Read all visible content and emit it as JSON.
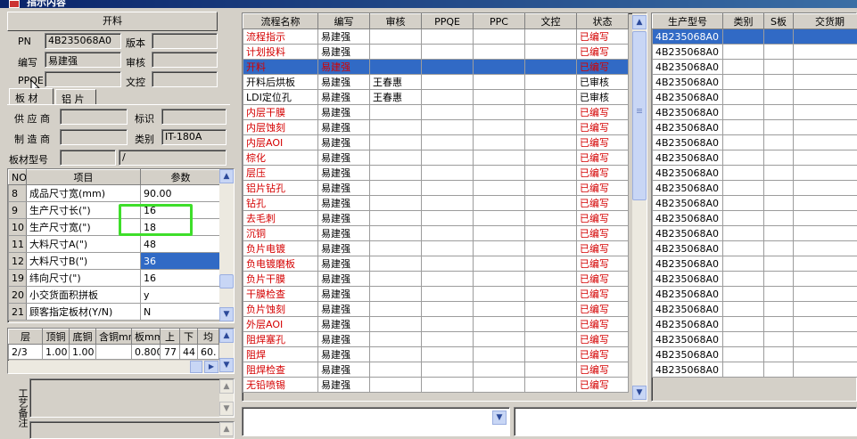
{
  "window": {
    "title": "指示内容"
  },
  "left_panel": {
    "header": "开料",
    "pn_label": "PN",
    "pn_value": "4B235068A0",
    "version_label": "版本",
    "author_label": "编写",
    "author_value": "易建强",
    "review_label": "审核",
    "ppqe_label": "PPQE",
    "doc_control_label": "文控",
    "tabs": [
      "板 材",
      "铝 片"
    ],
    "supplier_label": "供 应 商",
    "mark_label": "标识",
    "manufacturer_label": "制 造 商",
    "category_label": "类别",
    "category_value": "IT-180A",
    "board_model_label": "板材型号",
    "board_model_value": "/"
  },
  "params_table": {
    "headers": [
      "NO",
      "项目",
      "参数"
    ],
    "rows": [
      {
        "no": "8",
        "item": "成品尺寸宽(mm)",
        "value": "90.00"
      },
      {
        "no": "9",
        "item": "生产尺寸长(\")",
        "value": "16"
      },
      {
        "no": "10",
        "item": "生产尺寸宽(\")",
        "value": "18"
      },
      {
        "no": "11",
        "item": "大料尺寸A(\")",
        "value": "48"
      },
      {
        "no": "12",
        "item": "大料尺寸B(\")",
        "value": "36"
      },
      {
        "no": "19",
        "item": "纬向尺寸(\")",
        "value": "16"
      },
      {
        "no": "20",
        "item": "小交货面积拼板",
        "value": "y"
      },
      {
        "no": "21",
        "item": "顾客指定板材(Y/N)",
        "value": "N"
      }
    ],
    "highlighted_row_index": 4
  },
  "layer_table": {
    "headers": [
      "层",
      "顶铜",
      "底铜",
      "含铜mm",
      "板mm",
      "上",
      "下",
      "均"
    ],
    "rows": [
      [
        "2/3",
        "1.00",
        "1.00",
        "",
        "0.800",
        "77",
        "44",
        "60."
      ]
    ]
  },
  "remarks": {
    "label": "工艺备注"
  },
  "flow_table": {
    "headers": [
      "流程名称",
      "编写",
      "审核",
      "PPQE",
      "PPC",
      "文控",
      "状态"
    ],
    "rows": [
      {
        "name": "流程指示",
        "author": "易建强",
        "reviewer": "",
        "status": "已编写",
        "state": "draft"
      },
      {
        "name": "计划投料",
        "author": "易建强",
        "reviewer": "",
        "status": "已编写",
        "state": "draft"
      },
      {
        "name": "开料",
        "author": "易建强",
        "reviewer": "",
        "status": "已编写",
        "state": "selected"
      },
      {
        "name": "开料后烘板",
        "author": "易建强",
        "reviewer": "王春惠",
        "status": "已审核",
        "state": "reviewed"
      },
      {
        "name": "LDI定位孔",
        "author": "易建强",
        "reviewer": "王春惠",
        "status": "已审核",
        "state": "reviewed"
      },
      {
        "name": "内层干膜",
        "author": "易建强",
        "reviewer": "",
        "status": "已编写",
        "state": "draft"
      },
      {
        "name": "内层蚀刻",
        "author": "易建强",
        "reviewer": "",
        "status": "已编写",
        "state": "draft"
      },
      {
        "name": "内层AOI",
        "author": "易建强",
        "reviewer": "",
        "status": "已编写",
        "state": "draft"
      },
      {
        "name": "棕化",
        "author": "易建强",
        "reviewer": "",
        "status": "已编写",
        "state": "draft"
      },
      {
        "name": "层压",
        "author": "易建强",
        "reviewer": "",
        "status": "已编写",
        "state": "draft"
      },
      {
        "name": "铝片钻孔",
        "author": "易建强",
        "reviewer": "",
        "status": "已编写",
        "state": "draft"
      },
      {
        "name": "钻孔",
        "author": "易建强",
        "reviewer": "",
        "status": "已编写",
        "state": "draft"
      },
      {
        "name": "去毛刺",
        "author": "易建强",
        "reviewer": "",
        "status": "已编写",
        "state": "draft"
      },
      {
        "name": "沉铜",
        "author": "易建强",
        "reviewer": "",
        "status": "已编写",
        "state": "draft"
      },
      {
        "name": "负片电镀",
        "author": "易建强",
        "reviewer": "",
        "status": "已编写",
        "state": "draft"
      },
      {
        "name": "负电镀磨板",
        "author": "易建强",
        "reviewer": "",
        "status": "已编写",
        "state": "draft"
      },
      {
        "name": "负片干膜",
        "author": "易建强",
        "reviewer": "",
        "status": "已编写",
        "state": "draft"
      },
      {
        "name": "干膜检查",
        "author": "易建强",
        "reviewer": "",
        "status": "已编写",
        "state": "draft"
      },
      {
        "name": "负片蚀刻",
        "author": "易建强",
        "reviewer": "",
        "status": "已编写",
        "state": "draft"
      },
      {
        "name": "外层AOI",
        "author": "易建强",
        "reviewer": "",
        "status": "已编写",
        "state": "draft"
      },
      {
        "name": "阻焊塞孔",
        "author": "易建强",
        "reviewer": "",
        "status": "已编写",
        "state": "draft"
      },
      {
        "name": "阻焊",
        "author": "易建强",
        "reviewer": "",
        "status": "已编写",
        "state": "draft"
      },
      {
        "name": "阻焊检查",
        "author": "易建强",
        "reviewer": "",
        "status": "已编写",
        "state": "draft"
      },
      {
        "name": "无铅喷锡",
        "author": "易建强",
        "reviewer": "",
        "status": "已编写",
        "state": "draft"
      }
    ]
  },
  "production_table": {
    "headers": [
      "生产型号",
      "类别",
      "S板",
      "交货期"
    ],
    "model": "4B235068A0",
    "row_count": 23,
    "selected_row_index": 0
  },
  "colors": {
    "selection": "#316ac5",
    "draft_text": "#d40000",
    "highlight_box": "#3ede2a"
  }
}
